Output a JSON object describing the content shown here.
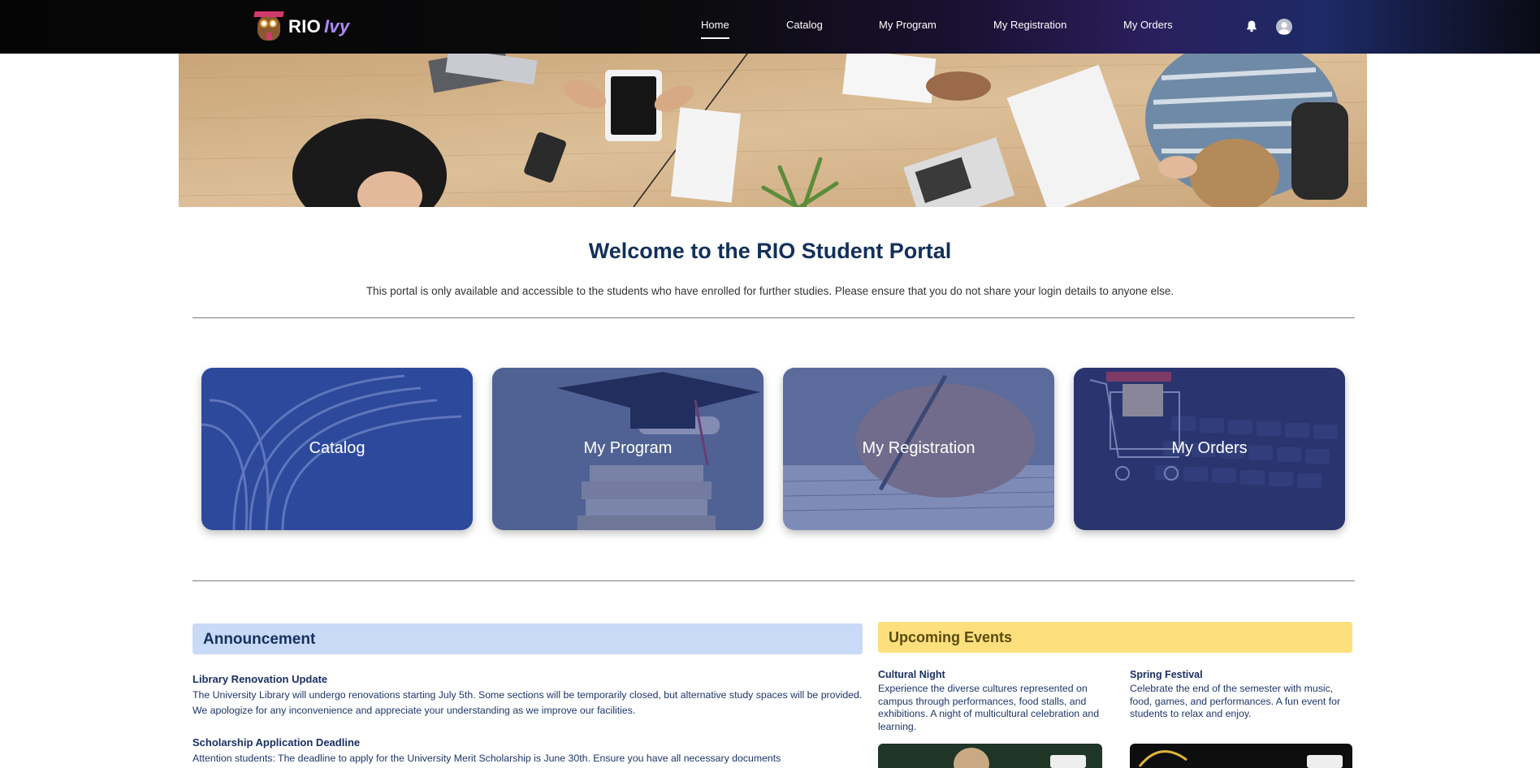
{
  "brand": {
    "name": "RIO",
    "suffix": "Ivy"
  },
  "nav": {
    "items": [
      "Home",
      "Catalog",
      "My Program",
      "My Registration",
      "My Orders"
    ]
  },
  "welcome": {
    "title": "Welcome to the RIO Student Portal",
    "subtitle": "This portal is only available and accessible to the students who have enrolled for further studies. Please ensure that you do not share your login details to anyone else."
  },
  "tiles": [
    "Catalog",
    "My Program",
    "My Registration",
    "My Orders"
  ],
  "announcement": {
    "heading": "Announcement",
    "items": [
      {
        "title": "Library Renovation Update",
        "text": "The University Library will undergo renovations starting July 5th. Some sections will be temporarily closed, but alternative study spaces will be provided. We apologize for any inconvenience and appreciate your understanding as we improve our facilities."
      },
      {
        "title": "Scholarship Application Deadline",
        "text": "Attention students: The deadline to apply for the University Merit Scholarship is June 30th. Ensure you have all necessary documents"
      }
    ]
  },
  "events": {
    "heading": "Upcoming Events",
    "items": [
      {
        "title": "Cultural Night",
        "text": "Experience the diverse cultures represented on campus through performances, food stalls, and exhibitions. A night of multicultural celebration and learning."
      },
      {
        "title": "Spring Festival",
        "text": "Celebrate the end of the semester with music, food, games, and performances. A fun event for students to relax and enjoy."
      }
    ]
  },
  "colors": {
    "announcement_bg": "#c8daf6",
    "events_bg": "#fde07d",
    "title_color": "#12305a"
  }
}
